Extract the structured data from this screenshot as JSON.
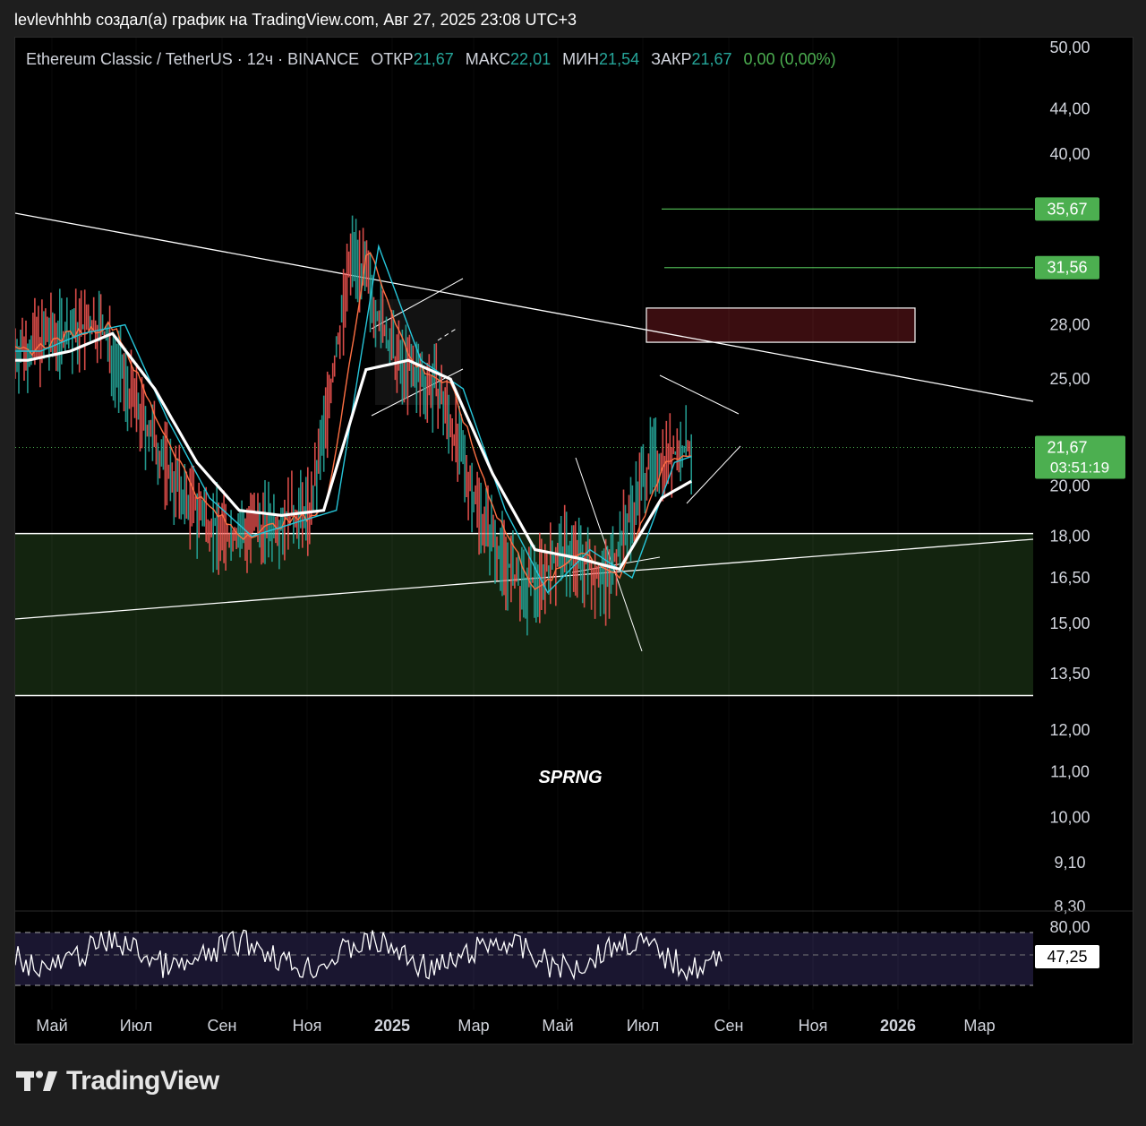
{
  "header": {
    "attribution": "levlevhhhb создал(а) график на TradingView.com, Авг 27, 2025 23:08 UTC+3"
  },
  "legend": {
    "symbol": "Ethereum Classic / TetherUS · 12ч · BINANCE",
    "open_label": "ОТКР",
    "open_value": "21,67",
    "high_label": "МАКС",
    "high_value": "22,01",
    "low_label": "МИН",
    "low_value": "21,54",
    "close_label": "ЗАКР",
    "close_value": "21,67",
    "change": "0,00 (0,00%)"
  },
  "price_axis": {
    "ticks": [
      "50,00",
      "44,00",
      "40,00",
      "28,00",
      "25,00",
      "20,00",
      "18,00",
      "16,50",
      "15,00",
      "13,50",
      "12,00",
      "11,00",
      "10,00",
      "9,10",
      "8,30"
    ],
    "badges": [
      {
        "label": "35,67"
      },
      {
        "label": "31,56"
      },
      {
        "label": "21,67",
        "sub": "03:51:19"
      }
    ]
  },
  "rsi_axis": {
    "ticks": [
      "80,00"
    ],
    "value_badge": "47,25"
  },
  "time_axis": {
    "labels": [
      "Май",
      "Июл",
      "Сен",
      "Ноя",
      "2025",
      "Мар",
      "Май",
      "Июл",
      "Сен",
      "Ноя",
      "2026",
      "Мар"
    ]
  },
  "annotation": "SPRNG",
  "brand": {
    "name": "TradingView"
  },
  "colors": {
    "background": "#000000",
    "up": "#26a69a",
    "down": "#ef5350",
    "zone_green": "#13240f",
    "zone_red": "#3a0d10",
    "target_green": "#4caf50",
    "ma_white": "#ffffff",
    "ma_cyan": "#26c6da",
    "ma_orange": "#ff7043"
  },
  "chart_data": {
    "type": "line",
    "symbol": "ETC/USDT",
    "timeframe": "12ч",
    "y_scale": "log",
    "ylim": [
      8.3,
      50
    ],
    "x": [
      "2024-04",
      "2024-05",
      "2024-06",
      "2024-07",
      "2024-08",
      "2024-09",
      "2024-10",
      "2024-11",
      "2024-12",
      "2025-01",
      "2025-02",
      "2025-03",
      "2025-04",
      "2025-05",
      "2025-06",
      "2025-07",
      "2025-08"
    ],
    "series": [
      {
        "values": [
          26.5,
          27.5,
          28.0,
          23.0,
          19.5,
          18.0,
          18.5,
          19.0,
          33.0,
          26.0,
          24.5,
          19.0,
          16.0,
          17.5,
          16.5,
          21.0,
          21.67
        ]
      },
      {
        "values": [
          26.0,
          26.5,
          27.5,
          24.5,
          21.0,
          19.0,
          18.8,
          19.0,
          25.5,
          26.0,
          25.0,
          20.5,
          17.5,
          17.2,
          16.8,
          19.5,
          20.5
        ]
      }
    ],
    "levels": [
      35.67,
      31.56,
      21.67
    ],
    "zones": [
      {
        "from": 12.9,
        "to": 18.1
      },
      {
        "from": 27.0,
        "to": 29.0
      }
    ],
    "rsi": {
      "last": 47.25
    }
  }
}
